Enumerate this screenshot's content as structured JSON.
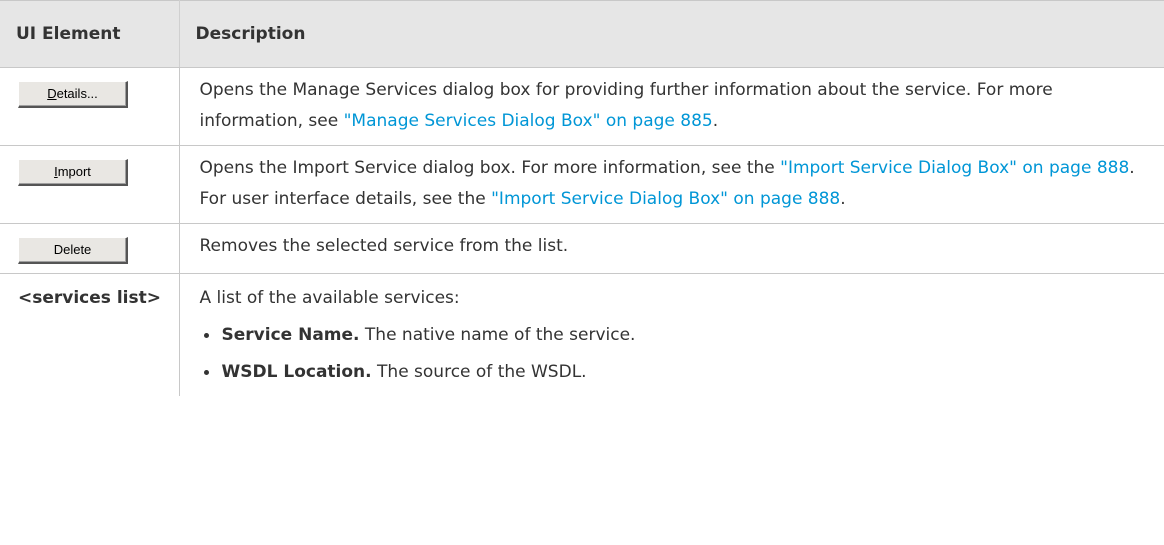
{
  "header": {
    "col1": "UI Element",
    "col2": "Description"
  },
  "rows": [
    {
      "button": {
        "pre": "",
        "accel": "D",
        "post": "etails..."
      },
      "desc": {
        "text1": "Opens the Manage Services dialog box for providing further information about the service. For more information, see ",
        "link1": "\"Manage Services Dialog Box\" on page 885",
        "text2": "."
      }
    },
    {
      "button": {
        "pre": "",
        "accel": "I",
        "post": "mport"
      },
      "desc": {
        "text1": "Opens the Import Service dialog box. For more information, see the ",
        "link1": "\"Import Service Dialog Box\" on page 888",
        "text2": ". For user interface details, see the ",
        "link2": "\"Import Service Dialog Box\" on page 888",
        "text3": "."
      }
    },
    {
      "button": {
        "label": "Delete"
      },
      "desc": {
        "text1": "Removes the selected service from the list."
      }
    },
    {
      "label": "<services list>",
      "desc": {
        "intro": "A list of the available services:",
        "items": [
          {
            "term": "Service Name.",
            "text": " The native name of the service."
          },
          {
            "term": "WSDL Location.",
            "text": " The source of the WSDL."
          }
        ]
      }
    }
  ]
}
